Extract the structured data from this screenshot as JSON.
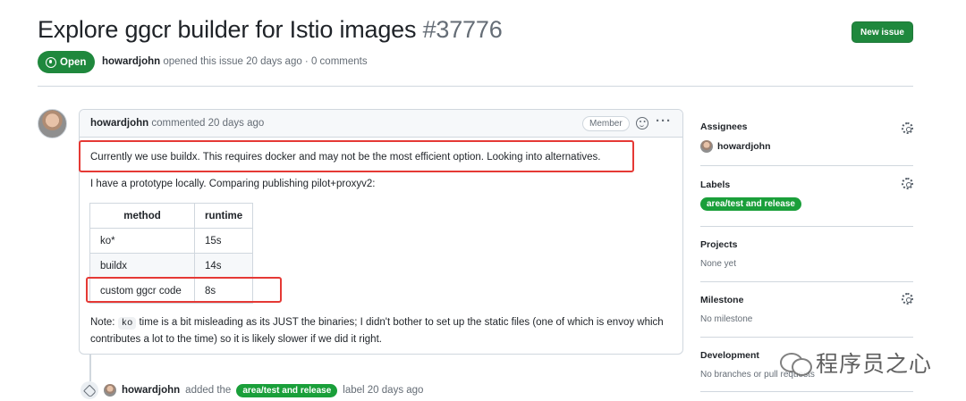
{
  "issue": {
    "title": "Explore ggcr builder for Istio images",
    "number": "#37776",
    "state": "Open",
    "author": "howardjohn",
    "opened_text": "opened this issue 20 days ago · 0 comments",
    "new_issue_label": "New issue"
  },
  "comment": {
    "author": "howardjohn",
    "time_text": "commented 20 days ago",
    "badge": "Member",
    "p1": "Currently we use buildx. This requires docker and may not be the most efficient option. Looking into alternatives.",
    "p2": "I have a prototype locally. Comparing publishing pilot+proxyv2:",
    "table": {
      "headers": [
        "method",
        "runtime"
      ],
      "rows": [
        [
          "ko*",
          "15s"
        ],
        [
          "buildx",
          "14s"
        ],
        [
          "custom ggcr code",
          "8s"
        ]
      ]
    },
    "p3_before": "Note: ",
    "p3_code": "ko",
    "p3_after": " time is a bit misleading as its JUST the binaries; I didn't bother to set up the static files (one of which is envoy which contributes a lot to the time) so it is likely slower if we did it right."
  },
  "event": {
    "actor": "howardjohn",
    "verb": "added the",
    "label": "area/test and release",
    "suffix": "label 20 days ago"
  },
  "sidebar": {
    "assignees_title": "Assignees",
    "assignee": "howardjohn",
    "labels_title": "Labels",
    "label": "area/test and release",
    "projects_title": "Projects",
    "projects_value": "None yet",
    "milestone_title": "Milestone",
    "milestone_value": "No milestone",
    "development_title": "Development",
    "development_value": "No branches or pull requests"
  },
  "watermark": {
    "text": "程序员之心"
  },
  "colors": {
    "open_green": "#1f883d",
    "label_green": "#1a9f3a",
    "highlight_red": "#e53935"
  }
}
